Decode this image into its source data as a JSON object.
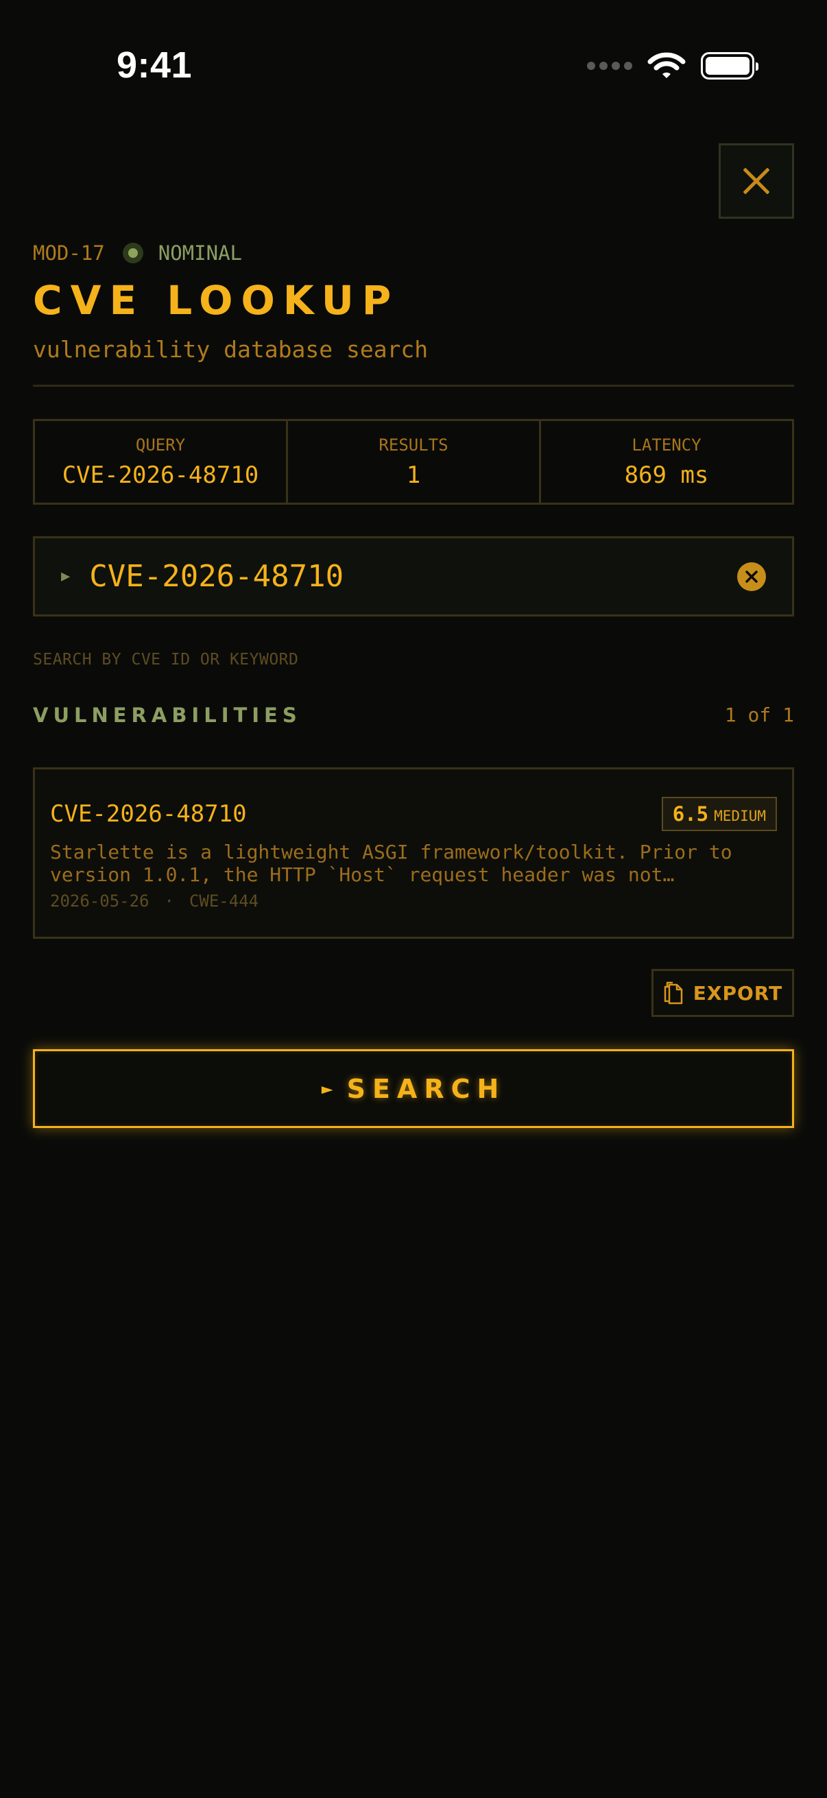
{
  "status_bar": {
    "time": "9:41"
  },
  "header": {
    "module_id": "MOD-17",
    "status": "NOMINAL",
    "title": "CVE LOOKUP",
    "subtitle": "vulnerability database search"
  },
  "stats": [
    {
      "label": "QUERY",
      "value": "CVE-2026-48710"
    },
    {
      "label": "RESULTS",
      "value": "1"
    },
    {
      "label": "LATENCY",
      "value": "869 ms"
    }
  ],
  "search": {
    "value": "CVE-2026-48710",
    "hint": "SEARCH BY CVE ID OR KEYWORD"
  },
  "results": {
    "section_title": "VULNERABILITIES",
    "count": "1 of 1",
    "items": [
      {
        "id": "CVE-2026-48710",
        "score": "6.5",
        "severity": "MEDIUM",
        "description": "Starlette is a lightweight ASGI framework/toolkit. Prior to version 1.0.1, the HTTP `Host` request header was not validated",
        "date": "2026-05-26",
        "separator": "·",
        "cwe": "CWE-444"
      }
    ]
  },
  "actions": {
    "export_label": "EXPORT",
    "search_arrow": "►",
    "search_label": "SEARCH"
  },
  "colors": {
    "accent": "#f5b21a",
    "status_green": "#8d9e62",
    "background": "#0a0b09"
  }
}
